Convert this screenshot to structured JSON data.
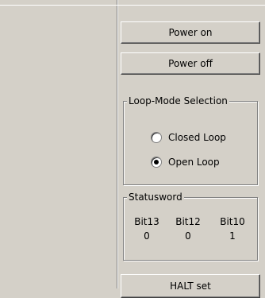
{
  "buttons": {
    "power_on": "Power on",
    "power_off": "Power off",
    "halt_set": "HALT set"
  },
  "loop_mode": {
    "title": "Loop-Mode Selection",
    "options": [
      {
        "label": "Closed Loop",
        "checked": false
      },
      {
        "label": "Open Loop",
        "checked": true
      }
    ]
  },
  "statusword": {
    "title": "Statusword",
    "bits": [
      {
        "name": "Bit13",
        "value": "0"
      },
      {
        "name": "Bit12",
        "value": "0"
      },
      {
        "name": "Bit10",
        "value": "1"
      }
    ]
  },
  "colors": {
    "background": "#d4d0c8",
    "highlight": "#ffffff",
    "shadow": "#808080"
  }
}
